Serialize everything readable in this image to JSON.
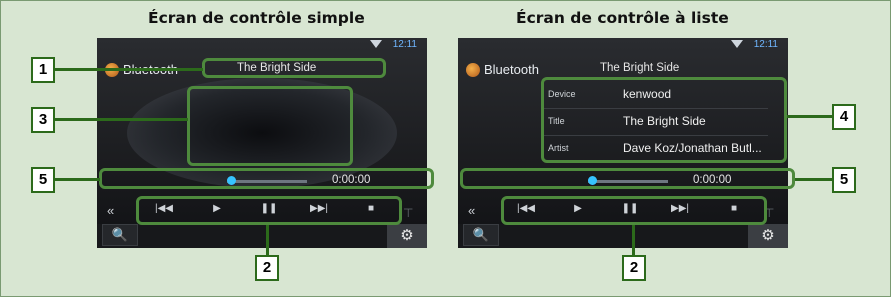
{
  "headings": {
    "left": "Écran de contrôle simple",
    "right": "Écran de contrôle à liste"
  },
  "status": {
    "clock": "12:11"
  },
  "left_screen": {
    "source_label": "Bluetooth",
    "track_title": "The Bright Side",
    "time": "0:00:00"
  },
  "right_screen": {
    "source_label": "Bluetooth",
    "track_title": "The Bright Side",
    "info": [
      {
        "key": "Device",
        "value": "kenwood"
      },
      {
        "key": "Title",
        "value": "The Bright Side"
      },
      {
        "key": "Artist",
        "value": "Dave Koz/Jonathan Butl..."
      }
    ],
    "time": "0:00:00"
  },
  "controls": {
    "back": "«",
    "prev": "|◀◀",
    "play": "▶",
    "pause": "❚❚",
    "next": "▶▶|",
    "stop": "■"
  },
  "callouts": [
    "1",
    "2",
    "3",
    "4",
    "5"
  ],
  "colors": {
    "background": "#d8e6d2",
    "callout_border": "#4e8a3d",
    "accent": "#36c3ff"
  }
}
